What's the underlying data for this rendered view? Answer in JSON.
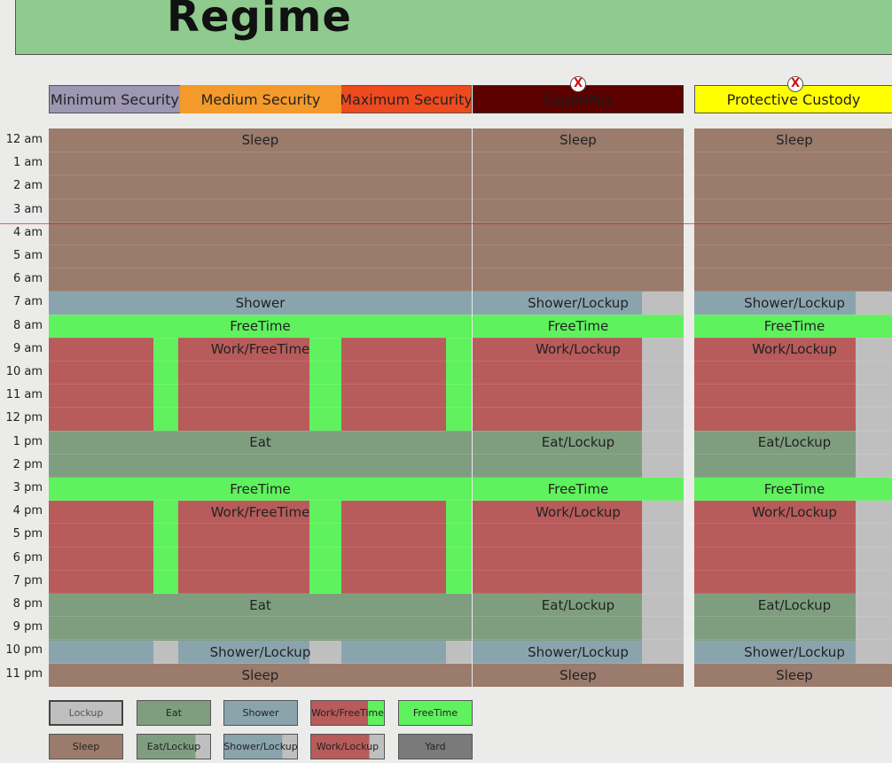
{
  "title": "Regime",
  "headers": {
    "minimum": "Minimum Security",
    "medium": "Medium Security",
    "maximum": "Maximum Security",
    "supermax": "SuperMax",
    "protective": "Protective Custody",
    "close_glyph": "X"
  },
  "hours": [
    "12 am",
    "1 am",
    "2 am",
    "3 am",
    "4 am",
    "5 am",
    "6 am",
    "7 am",
    "8 am",
    "9 am",
    "10 am",
    "11 am",
    "12 pm",
    "1 pm",
    "2 pm",
    "3 pm",
    "4 pm",
    "5 pm",
    "6 pm",
    "7 pm",
    "8 pm",
    "9 pm",
    "10 pm",
    "11 pm"
  ],
  "schedule": {
    "sleep": "Sleep",
    "shower": "Shower",
    "freetime": "FreeTime",
    "work_freetime": "Work/FreeTime",
    "eat": "Eat",
    "shower_lockup": "Shower/Lockup",
    "work_lockup": "Work/Lockup",
    "eat_lockup": "Eat/Lockup"
  },
  "legend": {
    "lockup": "Lockup",
    "eat": "Eat",
    "shower": "Shower",
    "work_freetime": "Work/FreeTime",
    "freetime": "FreeTime",
    "sleep": "Sleep",
    "eat_lockup": "Eat/Lockup",
    "shower_lockup": "Shower/Lockup",
    "work_lockup": "Work/Lockup",
    "yard": "Yard"
  },
  "colors": {
    "sleep": "#9a7b6c",
    "shower": "#8aa4ae",
    "freetime": "#5ff15e",
    "work": "#b85b5b",
    "eat": "#7f9e80",
    "lockup": "#bfbfbf",
    "yard": "#7a7a7a",
    "minimum": "#9d97b3",
    "medium": "#f49a2a",
    "maximum": "#ef4a1e",
    "supermax": "#5c0000",
    "protective": "#ffff00",
    "title_bg": "#8fca8e"
  }
}
